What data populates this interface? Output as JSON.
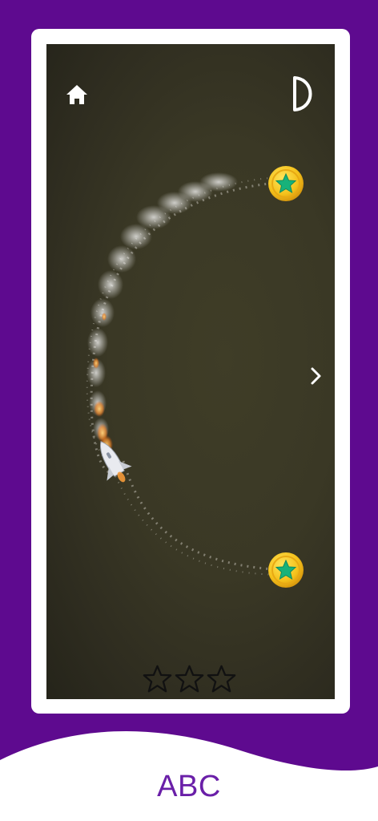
{
  "caption": "ABC",
  "level_glyph": "D",
  "icons": {
    "home": "home-icon",
    "next": "chevron-right-icon",
    "coin": "star-coin-icon",
    "rocket": "rocket-icon",
    "rating_star": "star-outline-icon"
  },
  "game": {
    "stars_total": 3,
    "stars_earned": 0,
    "coins_visible": 2
  },
  "colors": {
    "brand_purple": "#5e0a8f",
    "coin_gold": "#f4c11b",
    "coin_star": "#17b27a",
    "screen_bg": "#3a3825",
    "caption": "#6a1fa8"
  }
}
